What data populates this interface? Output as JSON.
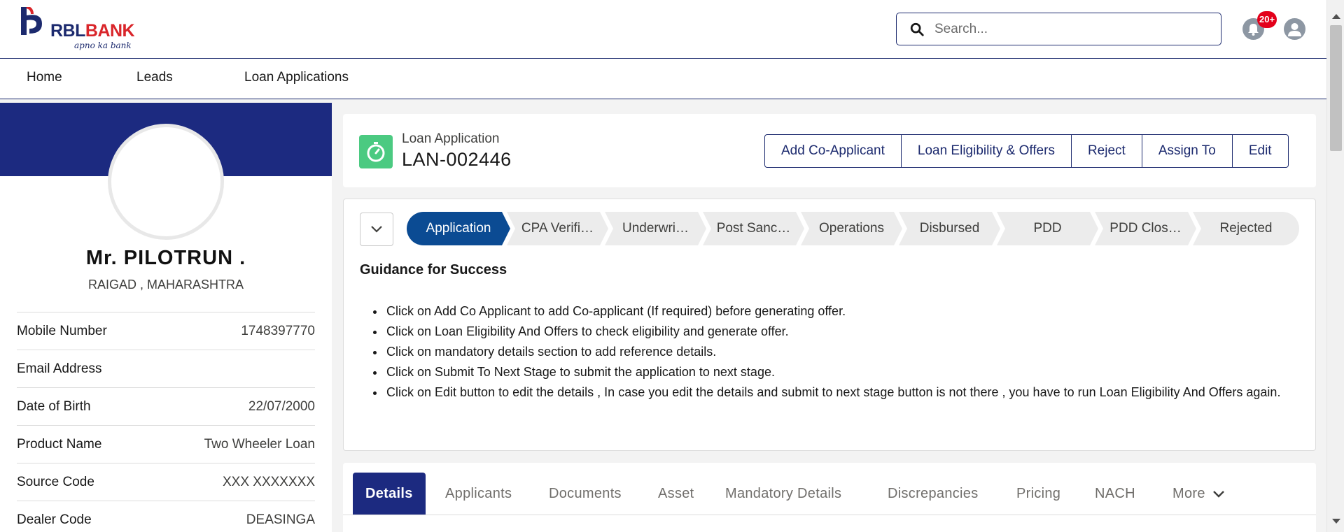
{
  "brand": {
    "name_part1": "RBL",
    "name_part2": "BANK",
    "tagline": "apno ka bank"
  },
  "colors": {
    "primary": "#1c2a80",
    "accent_red": "#d9252a",
    "active_step": "#0b4b93",
    "loan_icon": "#4bca81"
  },
  "search": {
    "placeholder": "Search..."
  },
  "notifications": {
    "badge": "20+"
  },
  "icons": {
    "search": "search-icon",
    "bell": "bell-icon",
    "user": "user-avatar-icon",
    "stopwatch": "stopwatch-icon",
    "chevron": "chevron-down-icon"
  },
  "nav": {
    "items": [
      {
        "label": "Home"
      },
      {
        "label": "Leads"
      },
      {
        "label": "Loan Applications"
      }
    ]
  },
  "profile": {
    "name": "Mr. PILOTRUN .",
    "location": "RAIGAD , MAHARASHTRA",
    "fields": [
      {
        "label": "Mobile Number",
        "value": "1748397770"
      },
      {
        "label": "Email Address",
        "value": ""
      },
      {
        "label": "Date of Birth",
        "value": "22/07/2000"
      },
      {
        "label": "Product Name",
        "value": "Two Wheeler Loan"
      },
      {
        "label": "Source Code",
        "value": "XXX XXXXXXX"
      },
      {
        "label": "Dealer Code",
        "value": "DEASINGA"
      }
    ]
  },
  "loan": {
    "label": "Loan Application",
    "id": "LAN-002446",
    "actions": [
      {
        "label": "Add Co-Applicant"
      },
      {
        "label": "Loan Eligibility & Offers"
      },
      {
        "label": "Reject"
      },
      {
        "label": "Assign To"
      },
      {
        "label": "Edit"
      }
    ]
  },
  "path": {
    "steps": [
      {
        "label": "Application",
        "active": true
      },
      {
        "label": "CPA Verifi…"
      },
      {
        "label": "Underwri…"
      },
      {
        "label": "Post Sanc…"
      },
      {
        "label": "Operations"
      },
      {
        "label": "Disbursed"
      },
      {
        "label": "PDD"
      },
      {
        "label": "PDD Clos…"
      },
      {
        "label": "Rejected"
      }
    ]
  },
  "guidance": {
    "title": "Guidance for Success",
    "items": [
      "Click on Add Co Applicant to add Co-applicant (If required) before generating offer.",
      "Click on Loan Eligibility And Offers to check eligibility and generate offer.",
      "Click on mandatory details section to add reference details.",
      "Click on Submit To Next Stage to submit the application to next stage.",
      "Click on Edit button to edit the details , In case you edit the details and submit to next stage button is not there , you have to run Loan Eligibility And Offers again."
    ]
  },
  "tabs": {
    "items": [
      {
        "label": "Details",
        "active": true
      },
      {
        "label": "Applicants"
      },
      {
        "label": "Documents"
      },
      {
        "label": "Asset"
      },
      {
        "label": "Mandatory Details"
      },
      {
        "label": "Discrepancies"
      },
      {
        "label": "Pricing"
      },
      {
        "label": "NACH"
      },
      {
        "label": "More"
      }
    ]
  }
}
